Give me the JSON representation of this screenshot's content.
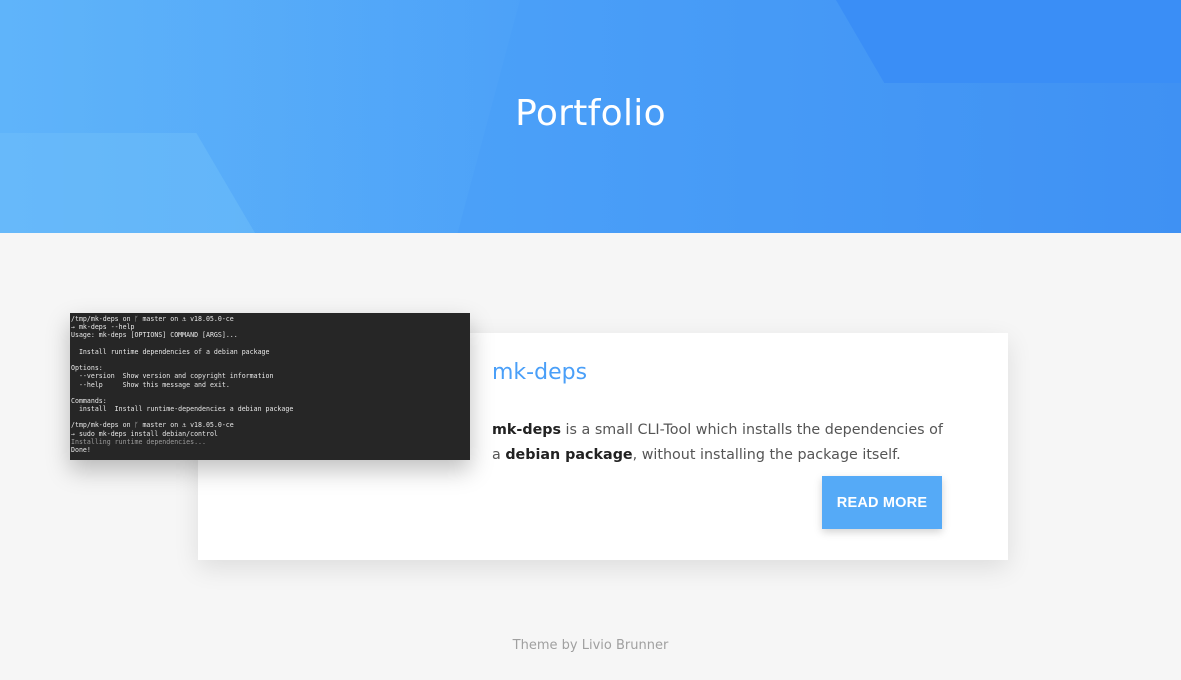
{
  "hero": {
    "title": "Portfolio"
  },
  "project": {
    "title": "mk-deps",
    "desc_name": "mk-deps",
    "desc_text1": " is a small CLI-Tool which installs the dependencies of a ",
    "desc_term": "debian package",
    "desc_text2": ", without installing the package itself.",
    "read_more_label": "READ MORE",
    "terminal_lines": [
      "/tmp/mk-deps on ᚴ master on ⚓ v18.05.0-ce",
      "→ mk-deps --help",
      "Usage: mk-deps [OPTIONS] COMMAND [ARGS]...",
      "",
      "  Install runtime dependencies of a debian package",
      "",
      "Options:",
      "  --version  Show version and copyright information",
      "  --help     Show this message and exit.",
      "",
      "Commands:",
      "  install  Install runtime-dependencies a debian package",
      "",
      "/tmp/mk-deps on ᚴ master on ⚓ v18.05.0-ce",
      "→ sudo mk-deps install debian/control",
      "Installing runtime dependencies...",
      "Done!"
    ]
  },
  "footer": {
    "prefix": "Theme by ",
    "author": "Livio Brunner"
  },
  "colors": {
    "accent": "#4a9ff8",
    "button": "#55aaf7"
  }
}
